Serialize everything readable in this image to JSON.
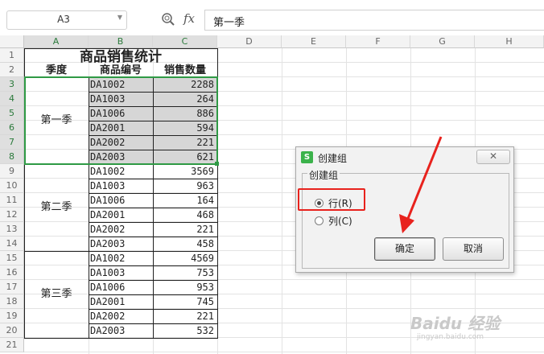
{
  "formula_bar": {
    "name_box": "A3",
    "fx_label": "fx",
    "formula": "第一季"
  },
  "columns": [
    "A",
    "B",
    "C",
    "D",
    "E",
    "F",
    "G",
    "H"
  ],
  "rows": [
    "1",
    "2",
    "3",
    "4",
    "5",
    "6",
    "7",
    "8",
    "9",
    "10",
    "11",
    "12",
    "13",
    "14",
    "15",
    "16",
    "17",
    "18",
    "19",
    "20",
    "21"
  ],
  "sheet": {
    "title": "商品销售统计",
    "headers": [
      "季度",
      "商品编号",
      "销售数量"
    ],
    "quarters": [
      "第一季",
      "第二季",
      "第三季"
    ],
    "codes": [
      "DA1002",
      "DA1003",
      "DA1006",
      "DA2001",
      "DA2002",
      "DA2003",
      "DA1002",
      "DA1003",
      "DA1006",
      "DA2001",
      "DA2002",
      "DA2003",
      "DA1002",
      "DA1003",
      "DA1006",
      "DA2001",
      "DA2002",
      "DA2003"
    ],
    "quantities": [
      "2288",
      "264",
      "886",
      "594",
      "221",
      "621",
      "3569",
      "963",
      "164",
      "468",
      "221",
      "458",
      "4569",
      "753",
      "953",
      "745",
      "221",
      "532"
    ]
  },
  "dialog": {
    "logo": "S",
    "title": "创建组",
    "close": "✕",
    "group_label": "创建组",
    "option_row": "行(R)",
    "option_col": "列(C)",
    "ok": "确定",
    "cancel": "取消",
    "selected": "row"
  },
  "watermark": {
    "text": "Baidu 经验",
    "sub": "jingyan.baidu.com"
  },
  "colors": {
    "selection": "#2f9a45",
    "highlight": "#e8221d",
    "arrow": "#e8221d"
  }
}
